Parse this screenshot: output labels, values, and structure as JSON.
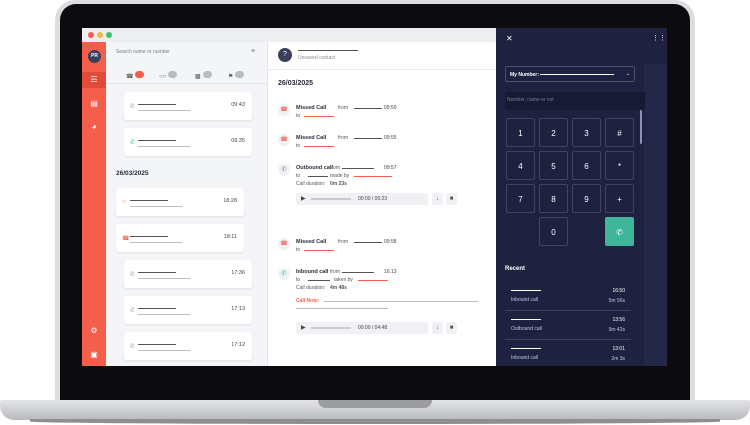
{
  "contacts": {
    "search_placeholder": "Search name or number",
    "filters": [
      {
        "icon": "missed-call-icon",
        "count": ""
      },
      {
        "icon": "voicemail-icon",
        "count": ""
      },
      {
        "icon": "message-icon",
        "count": ""
      },
      {
        "icon": "flag-icon",
        "count": ""
      }
    ],
    "cards_top": [
      {
        "icon": "phone-icon",
        "time": "09:43"
      },
      {
        "icon": "phone-icon",
        "time": "09:35"
      }
    ],
    "date_label": "26/03/2025",
    "cards_bottom": [
      {
        "icon": "voicemail-icon",
        "time": "18:28"
      },
      {
        "icon": "missed-call-icon",
        "time": "18:11"
      },
      {
        "icon": "phone-icon",
        "time": "17:36"
      },
      {
        "icon": "phone-icon",
        "time": "17:13"
      },
      {
        "icon": "phone-icon",
        "time": "17:12"
      }
    ]
  },
  "detail": {
    "avatar_label": "?",
    "contact_label": "Unsaved contact",
    "date": "26/03/2025",
    "events": [
      {
        "type": "missed",
        "title": "Missed Call",
        "from": "from",
        "to": "to",
        "time": "09:50"
      },
      {
        "type": "missed",
        "title": "Missed Call",
        "from": "from",
        "to": "to",
        "time": "09:55"
      },
      {
        "type": "outbound",
        "title": "Outbound call",
        "from": "from",
        "to": "to",
        "made_by": "made by",
        "time": "09:57",
        "duration_label": "Call duration:",
        "duration": "0m 23s",
        "player_time": "00:00 / 00:23"
      },
      {
        "type": "missed",
        "title": "Missed Call",
        "from": "from",
        "to": "to",
        "time": "09:58"
      },
      {
        "type": "inbound",
        "title": "Inbound call",
        "from": "from",
        "to": "to",
        "taken_by": "taken by",
        "time": "16:13",
        "duration_label": "Call duration:",
        "duration": "4m 48s",
        "note_label": "Call Note:",
        "player_time": "00:00 / 04:48"
      }
    ]
  },
  "dialer": {
    "my_number_label": "My Number:",
    "input_placeholder": "Number, name or ext",
    "keys": [
      "1",
      "2",
      "3",
      "#",
      "4",
      "5",
      "6",
      "*",
      "7",
      "8",
      "9",
      "+",
      "0"
    ],
    "recent_title": "Recent",
    "recent": [
      {
        "type": "Inbound call",
        "time": "16:50",
        "duration": "5m 56s"
      },
      {
        "type": "Outbound call",
        "time": "13:56",
        "duration": "9m 42s"
      },
      {
        "type": "Inbound call",
        "time": "13:01",
        "duration": "2m 3s"
      }
    ]
  },
  "colors": {
    "brand": "#f45e4a",
    "dialer_bg": "#1e2240",
    "call_button": "#3fb59a"
  }
}
